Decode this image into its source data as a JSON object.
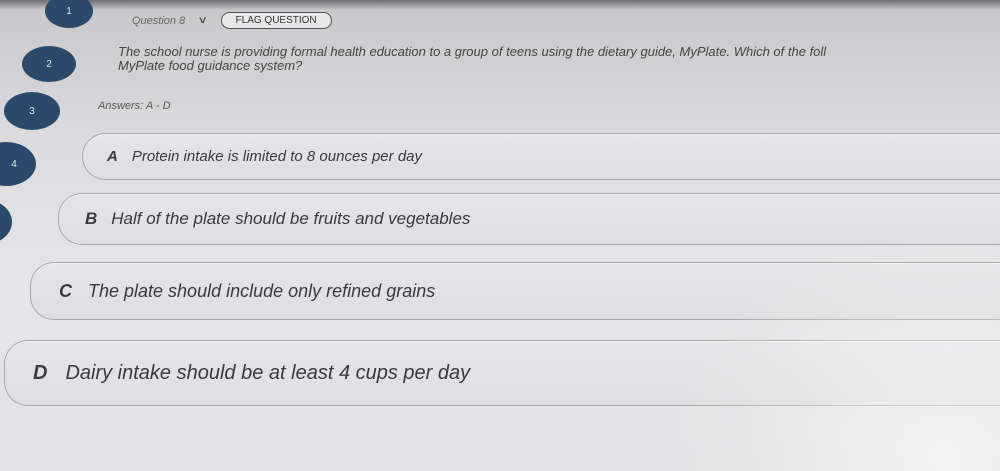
{
  "nav": {
    "question_numbers": [
      "1",
      "2",
      "3",
      "4"
    ]
  },
  "header": {
    "question_label": "Question 8",
    "chevron_icon": "chevron-down-icon",
    "flag_label": "FLAG QUESTION"
  },
  "question": {
    "text_line1": "The school nurse is providing formal health education to a group of teens using the dietary guide, MyPlate. Which of the foll",
    "text_line2": "MyPlate food guidance system?"
  },
  "answers_label": "Answers: A - D",
  "options": [
    {
      "letter": "A",
      "text": "Protein intake is limited to 8 ounces per day"
    },
    {
      "letter": "B",
      "text": "Half of the plate should be fruits and vegetables"
    },
    {
      "letter": "C",
      "text": "The plate should include only refined grains"
    },
    {
      "letter": "D",
      "text": "Dairy intake should be at least 4 cups per day"
    }
  ],
  "colors": {
    "nav_bubble": "#2b4a6b",
    "background": "#e4e4e6"
  }
}
